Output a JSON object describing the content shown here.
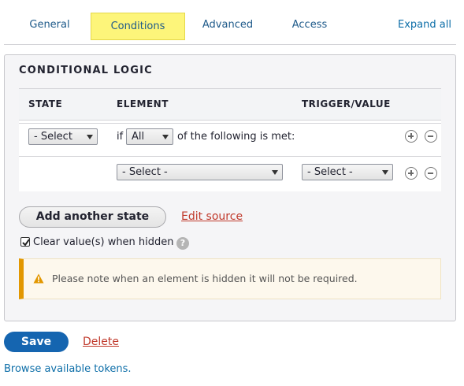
{
  "tabs": [
    {
      "label": "General"
    },
    {
      "label": "Conditions",
      "active": true
    },
    {
      "label": "Advanced"
    },
    {
      "label": "Access"
    }
  ],
  "expand_all": "Expand all",
  "panel": {
    "legend": "CONDITIONAL LOGIC",
    "columns": [
      "STATE",
      "ELEMENT",
      "TRIGGER/VALUE"
    ],
    "row1": {
      "state_select": "- Select",
      "if_text": "if",
      "condition_select": "All",
      "suffix_text": "of the following is met:"
    },
    "row2": {
      "element_select": "- Select -",
      "trigger_select": "- Select -"
    },
    "add_state_label": "Add another state",
    "edit_source_label": "Edit source",
    "clear_values_label": "Clear value(s) when hidden",
    "help_glyph": "?",
    "warning_text": "Please note when an element is hidden it will not be required.",
    "warning_color": "#e29700"
  },
  "footer": {
    "save_label": "Save",
    "delete_label": "Delete",
    "tokens_label": "Browse available tokens."
  }
}
